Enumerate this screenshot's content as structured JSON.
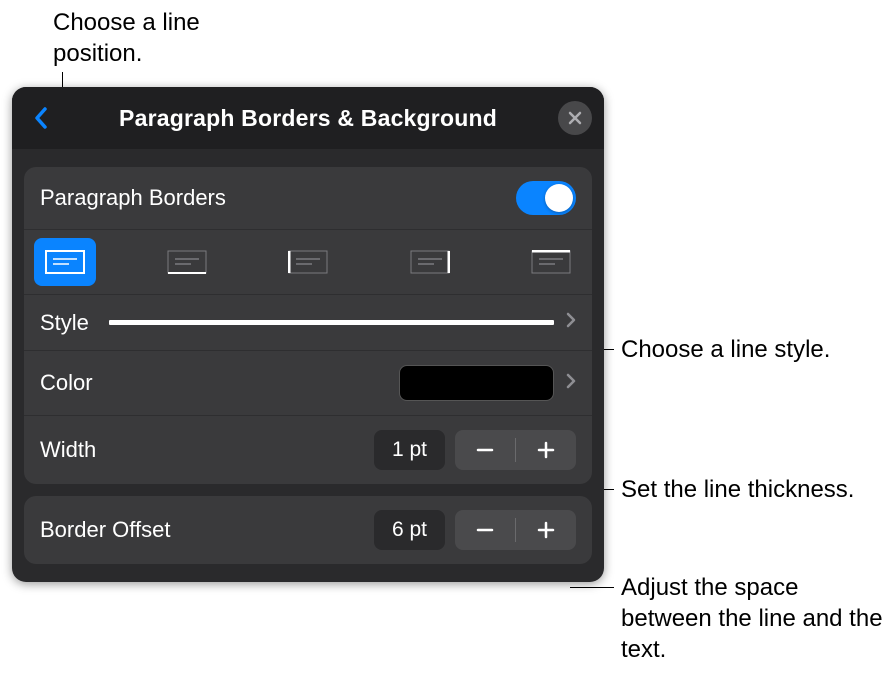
{
  "callouts": {
    "top": "Choose a line\nposition.",
    "style": "Choose a\nline style.",
    "width": "Set the line\nthickness.",
    "offset": "Adjust the space\nbetween the line\nand the text."
  },
  "panel": {
    "title": "Paragraph Borders & Background",
    "toggle_label": "Paragraph Borders",
    "toggle_on": true,
    "style_label": "Style",
    "color_label": "Color",
    "width_label": "Width",
    "width_value": "1 pt",
    "offset_label": "Border Offset",
    "offset_value": "6 pt",
    "color_value": "#000000"
  }
}
